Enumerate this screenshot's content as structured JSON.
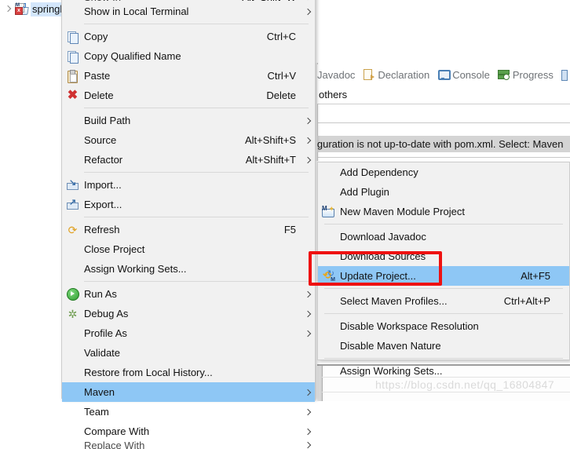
{
  "workbench": {
    "tree_item": {
      "label": "springb",
      "icon": "maven-java-project-icon",
      "twisty": "chevron-right-icon"
    },
    "view_tabs": [
      {
        "label": "Javadoc",
        "icon": "javadoc-icon"
      },
      {
        "label": "Declaration",
        "icon": "declaration-icon"
      },
      {
        "label": "Console",
        "icon": "console-icon"
      },
      {
        "label": "Progress",
        "icon": "progress-icon"
      },
      {
        "label": "",
        "icon": "partial-view-icon"
      }
    ],
    "others_label": "others",
    "collapse_icon": "chevron-up-icon",
    "problem_text": "iguration is not up-to-date with pom.xml. Select: Maven",
    "watermark": "https://blog.csdn.net/qq_16804847"
  },
  "context_menu": {
    "name": "project-context-menu",
    "items": [
      {
        "type": "item",
        "label": "Show in Local Terminal",
        "accel": "",
        "submenu": true,
        "icon": ""
      },
      {
        "type": "sep"
      },
      {
        "type": "item",
        "label": "Copy",
        "accel": "Ctrl+C",
        "submenu": false,
        "icon": "copy-icon"
      },
      {
        "type": "item",
        "label": "Copy Qualified Name",
        "accel": "",
        "submenu": false,
        "icon": "copy-qualified-name-icon"
      },
      {
        "type": "item",
        "label": "Paste",
        "accel": "Ctrl+V",
        "submenu": false,
        "icon": "paste-icon"
      },
      {
        "type": "item",
        "label": "Delete",
        "accel": "Delete",
        "submenu": false,
        "icon": "delete-icon"
      },
      {
        "type": "sep"
      },
      {
        "type": "item",
        "label": "Build Path",
        "accel": "",
        "submenu": true,
        "icon": ""
      },
      {
        "type": "item",
        "label": "Source",
        "accel": "Alt+Shift+S",
        "submenu": true,
        "icon": ""
      },
      {
        "type": "item",
        "label": "Refactor",
        "accel": "Alt+Shift+T",
        "submenu": true,
        "icon": ""
      },
      {
        "type": "sep"
      },
      {
        "type": "item",
        "label": "Import...",
        "accel": "",
        "submenu": false,
        "icon": "import-icon"
      },
      {
        "type": "item",
        "label": "Export...",
        "accel": "",
        "submenu": false,
        "icon": "export-icon"
      },
      {
        "type": "sep"
      },
      {
        "type": "item",
        "label": "Refresh",
        "accel": "F5",
        "submenu": false,
        "icon": "refresh-icon"
      },
      {
        "type": "item",
        "label": "Close Project",
        "accel": "",
        "submenu": false,
        "icon": ""
      },
      {
        "type": "item",
        "label": "Assign Working Sets...",
        "accel": "",
        "submenu": false,
        "icon": ""
      },
      {
        "type": "sep"
      },
      {
        "type": "item",
        "label": "Run As",
        "accel": "",
        "submenu": true,
        "icon": "run-icon"
      },
      {
        "type": "item",
        "label": "Debug As",
        "accel": "",
        "submenu": true,
        "icon": "debug-icon"
      },
      {
        "type": "item",
        "label": "Profile As",
        "accel": "",
        "submenu": true,
        "icon": ""
      },
      {
        "type": "item",
        "label": "Validate",
        "accel": "",
        "submenu": false,
        "icon": ""
      },
      {
        "type": "item",
        "label": "Restore from Local History...",
        "accel": "",
        "submenu": false,
        "icon": ""
      },
      {
        "type": "item",
        "label": "Maven",
        "accel": "",
        "submenu": true,
        "icon": "",
        "selected": true
      },
      {
        "type": "item",
        "label": "Team",
        "accel": "",
        "submenu": true,
        "icon": ""
      },
      {
        "type": "item",
        "label": "Compare With",
        "accel": "",
        "submenu": true,
        "icon": ""
      }
    ]
  },
  "maven_submenu": {
    "name": "maven-submenu",
    "items": [
      {
        "type": "item",
        "label": "Add Dependency",
        "accel": "",
        "icon": ""
      },
      {
        "type": "item",
        "label": "Add Plugin",
        "accel": "",
        "icon": ""
      },
      {
        "type": "item",
        "label": "New Maven Module Project",
        "accel": "",
        "icon": "new-maven-module-icon"
      },
      {
        "type": "sep"
      },
      {
        "type": "item",
        "label": "Download Javadoc",
        "accel": "",
        "icon": ""
      },
      {
        "type": "item",
        "label": "Download Sources",
        "accel": "",
        "icon": ""
      },
      {
        "type": "item",
        "label": "Update Project...",
        "accel": "Alt+F5",
        "icon": "update-project-icon",
        "selected": true
      },
      {
        "type": "sep"
      },
      {
        "type": "item",
        "label": "Select Maven Profiles...",
        "accel": "Ctrl+Alt+P",
        "icon": ""
      },
      {
        "type": "sep"
      },
      {
        "type": "item",
        "label": "Disable Workspace Resolution",
        "accel": "",
        "icon": ""
      },
      {
        "type": "item",
        "label": "Disable Maven Nature",
        "accel": "",
        "icon": ""
      },
      {
        "type": "sep"
      },
      {
        "type": "item",
        "label": "Assign Working Sets...",
        "accel": "",
        "icon": ""
      }
    ]
  },
  "annotation": {
    "name": "red-highlight-box",
    "color": "#ee1111",
    "target": "Update Project..."
  },
  "colors": {
    "menu_background": "#f1f1f1",
    "selection": "#8ec7f5",
    "tree_selection": "#d3e6fb",
    "problem_band": "#d4d4d4",
    "annotation_red": "#ee1111"
  }
}
